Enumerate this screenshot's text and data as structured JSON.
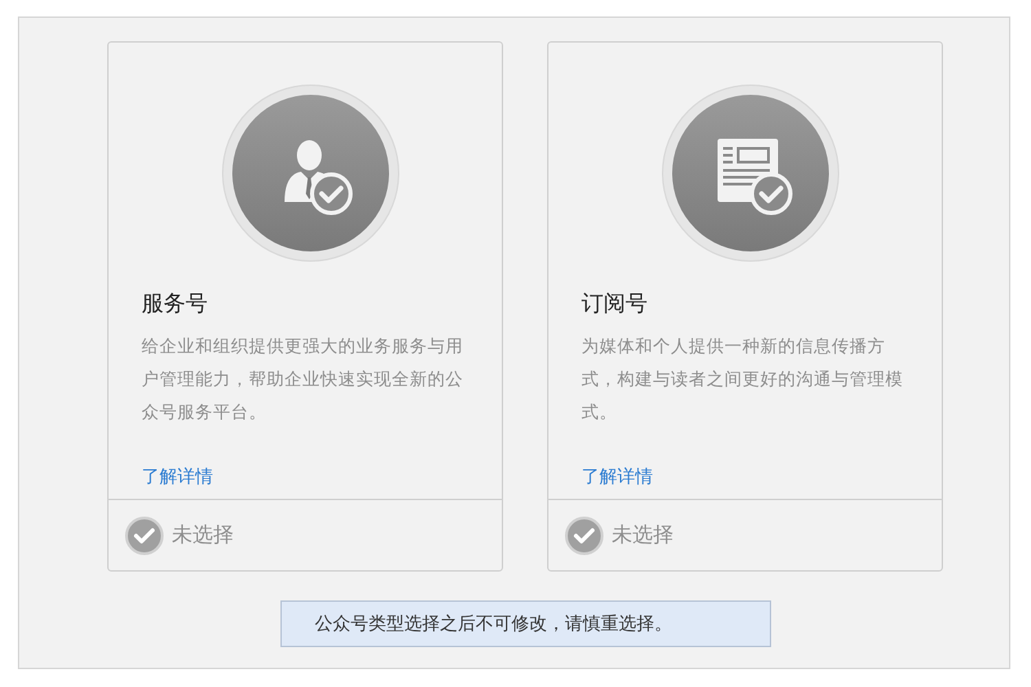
{
  "cards": [
    {
      "kind": "person",
      "title": "服务号",
      "description": "给企业和组织提供更强大的业务服务与用户管理能力，帮助企业快速实现全新的公众号服务平台。",
      "link": "了解详情",
      "selected": false,
      "status": "未选择"
    },
    {
      "kind": "article",
      "title": "订阅号",
      "description": "为媒体和个人提供一种新的信息传播方式，构建与读者之间更好的沟通与管理模式。",
      "link": "了解详情",
      "selected": false,
      "status": "未选择"
    }
  ],
  "notice": "公众号类型选择之后不可修改，请慎重选择。"
}
